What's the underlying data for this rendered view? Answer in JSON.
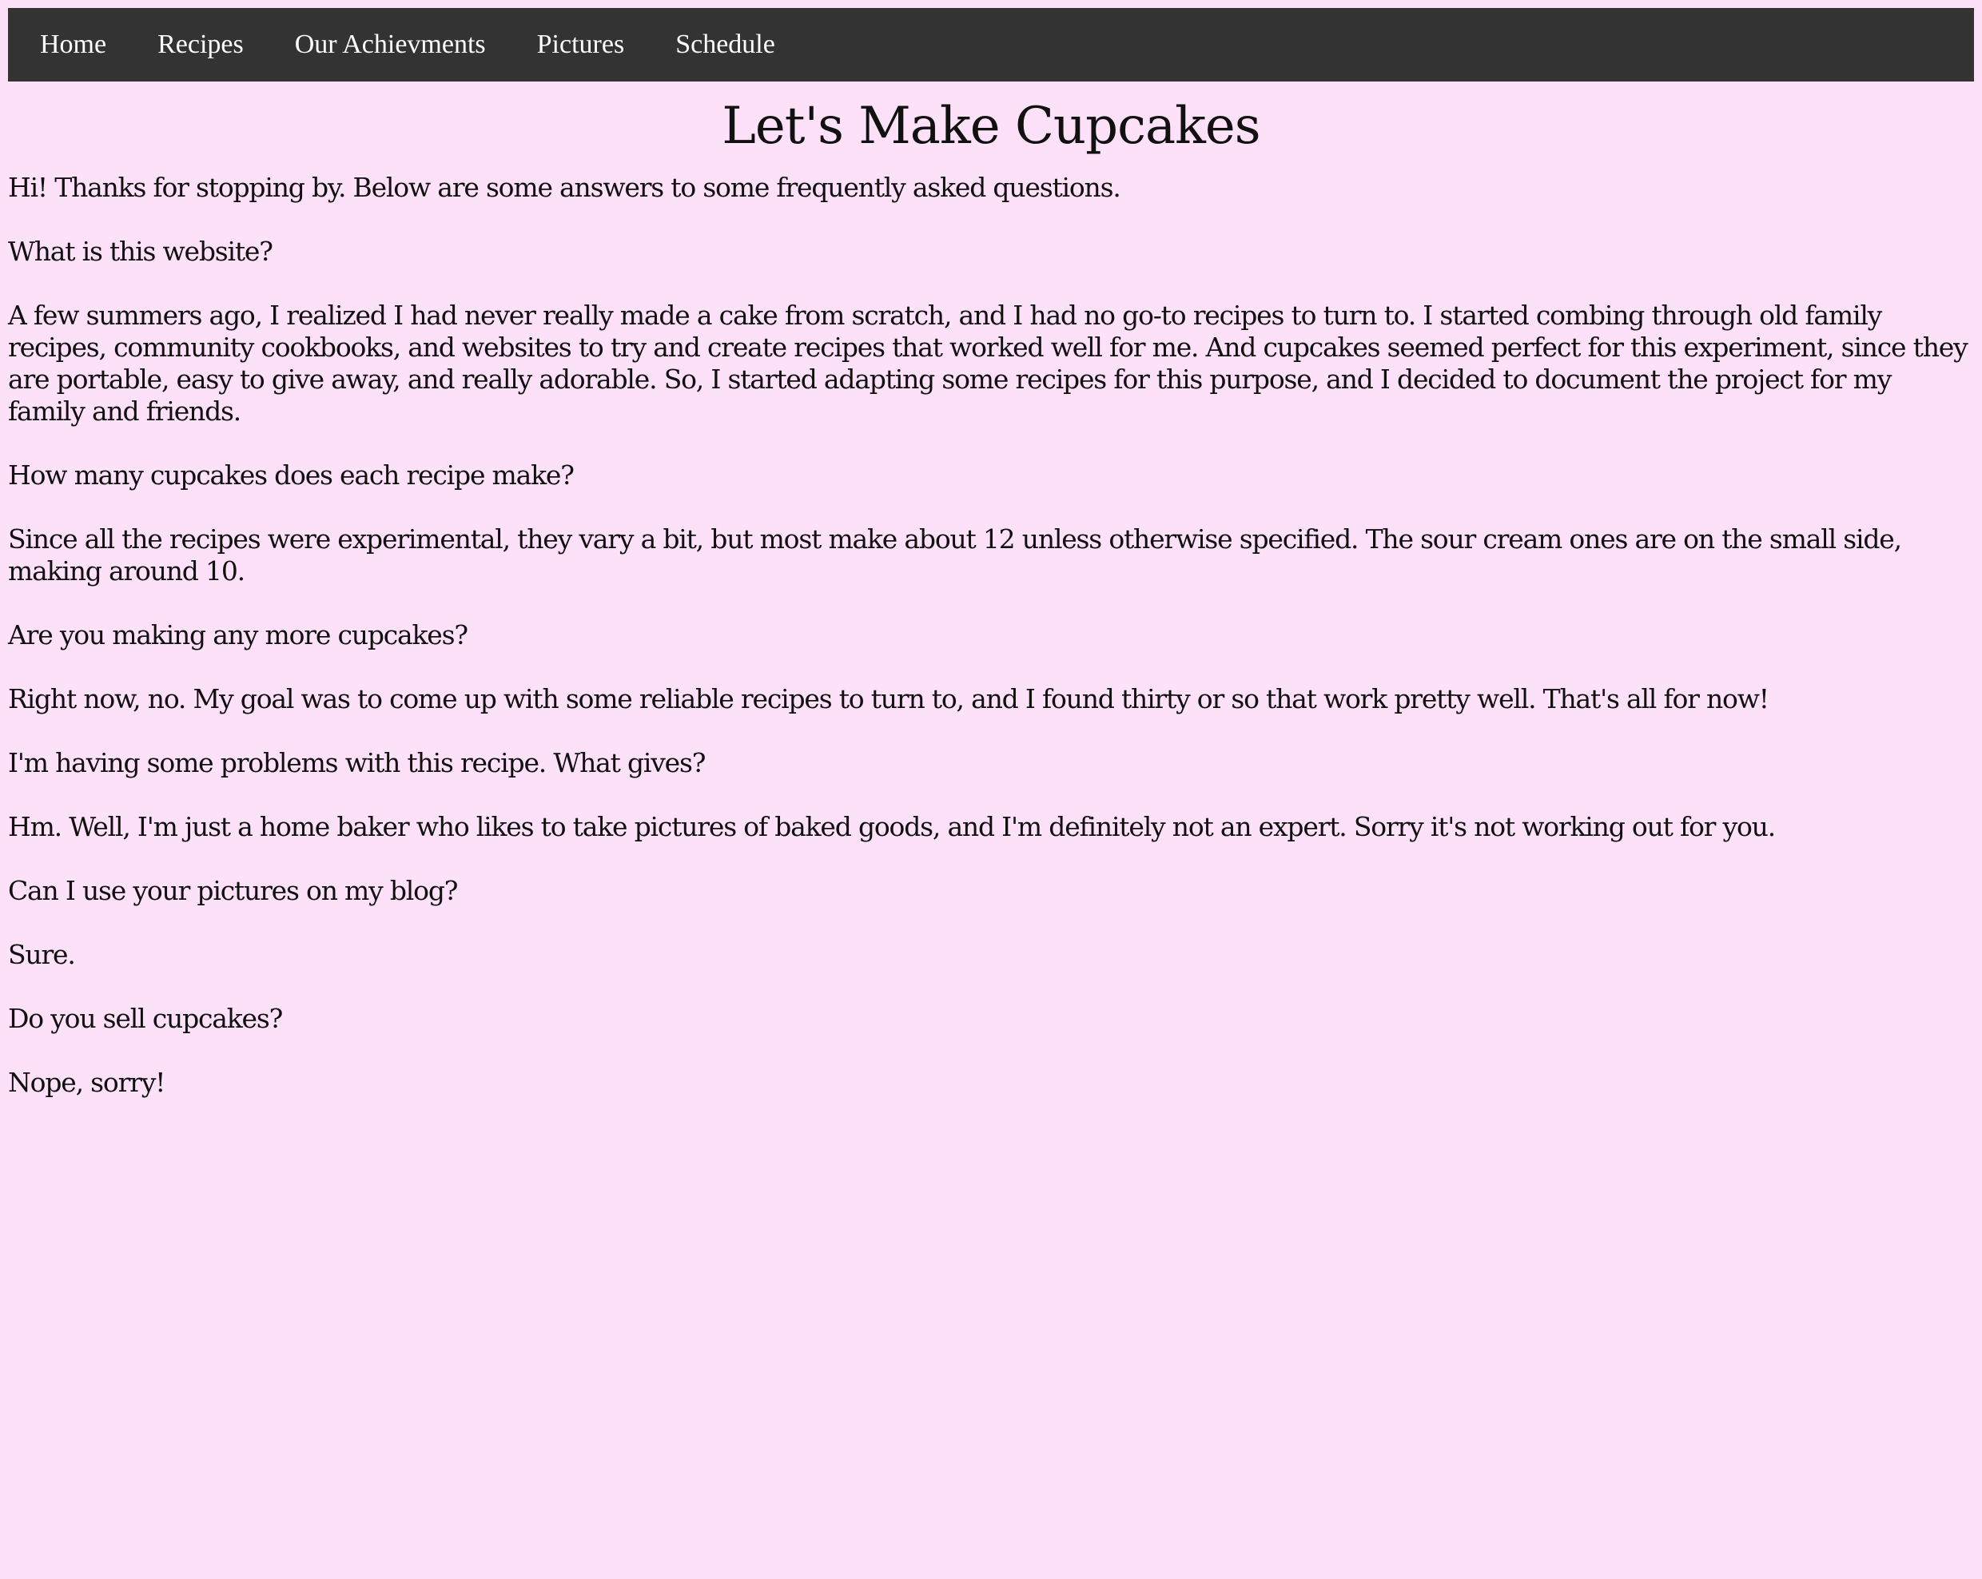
{
  "nav": {
    "items": [
      "Home",
      "Recipes",
      "Our Achievments",
      "Pictures",
      "Schedule"
    ]
  },
  "page": {
    "title": "Let's Make Cupcakes"
  },
  "content": {
    "intro": "Hi! Thanks for stopping by. Below are some answers to some frequently asked questions.",
    "faq": [
      {
        "question": "What is this website?",
        "answer": "A few summers ago, I realized I had never really made a cake from scratch, and I had no go-to recipes to turn to. I started combing through old family recipes, community cookbooks, and websites to try and create recipes that worked well for me. And cupcakes seemed perfect for this experiment, since they are portable, easy to give away, and really adorable. So, I started adapting some recipes for this purpose, and I decided to document the project for my family and friends."
      },
      {
        "question": "How many cupcakes does each recipe make?",
        "answer": "Since all the recipes were experimental, they vary a bit, but most make about 12 unless otherwise specified. The sour cream ones are on the small side, making around 10."
      },
      {
        "question": "Are you making any more cupcakes?",
        "answer": "Right now, no. My goal was to come up with some reliable recipes to turn to, and I found thirty or so that work pretty well. That's all for now!"
      },
      {
        "question": "I'm having some problems with this recipe. What gives?",
        "answer": "Hm. Well, I'm just a home baker who likes to take pictures of baked goods, and I'm definitely not an expert. Sorry it's not working out for you."
      },
      {
        "question": "Can I use your pictures on my blog?",
        "answer": "Sure."
      },
      {
        "question": "Do you sell cupcakes?",
        "answer": "Nope, sorry!"
      }
    ]
  },
  "colors": {
    "background": "#fde1f8",
    "nav_background": "#333333",
    "nav_text": "#ffffff",
    "text": "#111111"
  }
}
